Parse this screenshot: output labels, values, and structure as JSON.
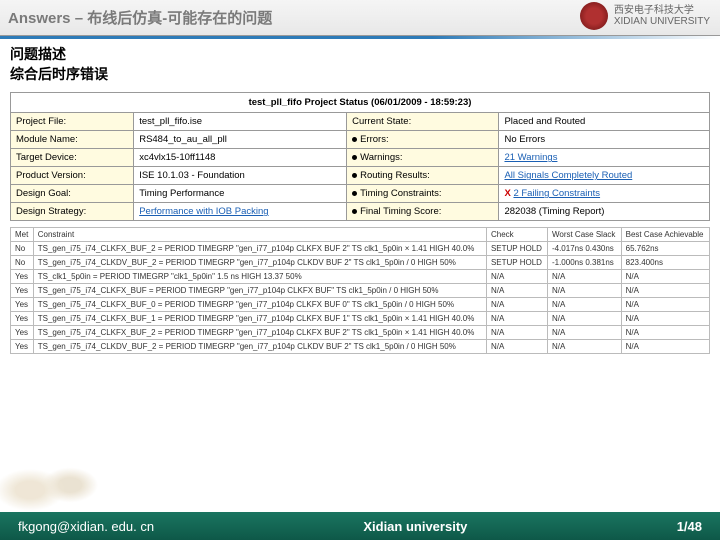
{
  "header": {
    "title": "Answers – 布线后仿真-可能存在的问题",
    "uni_cn": "西安电子科技大学",
    "uni_en": "XIDIAN UNIVERSITY"
  },
  "section": {
    "line1": "问题描述",
    "line2": "综合后时序错误"
  },
  "status": {
    "title": "test_pll_fifo Project Status (06/01/2009 - 18:59:23)",
    "r0": {
      "a": "Project File:",
      "b": "test_pll_fifo.ise",
      "c": "Current State:",
      "d": "Placed and Routed"
    },
    "r1": {
      "a": "Module Name:",
      "b": "RS484_to_au_all_pll",
      "c": "Errors:",
      "d": "No Errors"
    },
    "r2": {
      "a": "Target Device:",
      "b": "xc4vlx15-10ff1148",
      "c": "Warnings:",
      "d": "21 Warnings"
    },
    "r3": {
      "a": "Product Version:",
      "b": "ISE 10.1.03 - Foundation",
      "c": "Routing Results:",
      "d": "All Signals Completely Routed"
    },
    "r4": {
      "a": "Design Goal:",
      "b": "Timing Performance",
      "c": "Timing Constraints:",
      "d": "2 Failing Constraints",
      "x": "X"
    },
    "r5": {
      "a": "Design Strategy:",
      "b": "Performance with IOB Packing",
      "c": "Final Timing Score:",
      "d": "282038 (Timing Report)"
    }
  },
  "timing": {
    "h": {
      "met": "Met",
      "con": "Constraint",
      "chk": "Check",
      "wcs": "Worst Case Slack",
      "bca": "Best Case Achievable"
    },
    "rows": [
      {
        "met": "No",
        "con": "TS_gen_i75_i74_CLKFX_BUF_2 = PERIOD TIMEGRP \"gen_i77_p104p CLKFX BUF 2\" TS clk1_5p0in × 1.41 HIGH 40.0%",
        "chk": "SETUP HOLD",
        "wcs": "-4.017ns 0.430ns",
        "bca": "65.762ns"
      },
      {
        "met": "No",
        "con": "TS_gen_i75_i74_CLKDV_BUF_2 = PERIOD TIMEGRP \"gen_i77_p104p CLKDV BUF 2\" TS clk1_5p0in / 0 HIGH 50%",
        "chk": "SETUP HOLD",
        "wcs": "-1.000ns 0.381ns",
        "bca": "823.400ns"
      },
      {
        "met": "Yes",
        "con": "TS_clk1_5p0in = PERIOD TIMEGRP \"clk1_5p0in\" 1.5 ns HIGH 13.37 50%",
        "chk": "N/A",
        "wcs": "N/A",
        "bca": "N/A"
      },
      {
        "met": "Yes",
        "con": "TS_gen_i75_i74_CLKFX_BUF = PERIOD TIMEGRP \"gen_i77_p104p CLKFX BUF\" TS clk1_5p0in / 0 HIGH 50%",
        "chk": "N/A",
        "wcs": "N/A",
        "bca": "N/A"
      },
      {
        "met": "Yes",
        "con": "TS_gen_i75_i74_CLKFX_BUF_0 = PERIOD TIMEGRP \"gen_i77_p104p CLKFX BUF 0\" TS clk1_5p0in / 0 HIGH 50%",
        "chk": "N/A",
        "wcs": "N/A",
        "bca": "N/A"
      },
      {
        "met": "Yes",
        "con": "TS_gen_i75_i74_CLKFX_BUF_1 = PERIOD TIMEGRP \"gen_i77_p104p CLKFX BUF 1\" TS clk1_5p0in × 1.41 HIGH 40.0%",
        "chk": "N/A",
        "wcs": "N/A",
        "bca": "N/A"
      },
      {
        "met": "Yes",
        "con": "TS_gen_i75_i74_CLKFX_BUF_2 = PERIOD TIMEGRP \"gen_i77_p104p CLKFX BUF 2\" TS clk1_5p0in × 1.41 HIGH 40.0%",
        "chk": "N/A",
        "wcs": "N/A",
        "bca": "N/A"
      },
      {
        "met": "Yes",
        "con": "TS_gen_i75_i74_CLKDV_BUF_2 = PERIOD TIMEGRP \"gen_i77_p104p CLKDV BUF 2\" TS clk1_5p0in / 0 HIGH 50%",
        "chk": "N/A",
        "wcs": "N/A",
        "bca": "N/A"
      }
    ]
  },
  "footer": {
    "email": "fkgong@xidian. edu. cn",
    "uni": "Xidian university",
    "page": "1/48"
  }
}
